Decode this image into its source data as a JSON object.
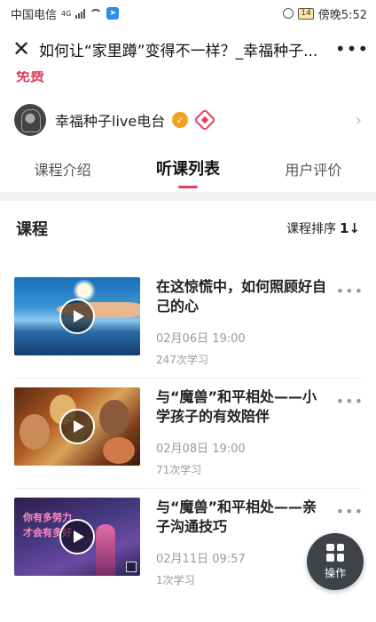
{
  "status_bar": {
    "carrier": "中国电信",
    "network": "4G",
    "battery": "14",
    "time": "傍晚5:52"
  },
  "title_bar": {
    "title": "如何让“家里蹲”变得不一样？_幸福种子..."
  },
  "free_label": "免费",
  "channel": {
    "name": "幸福种子live电台"
  },
  "tabs": [
    {
      "label": "课程介绍",
      "active": false
    },
    {
      "label": "听课列表",
      "active": true
    },
    {
      "label": "用户评价",
      "active": false
    }
  ],
  "course_section": {
    "heading": "课程",
    "sort_label": "课程排序",
    "sort_icon": "1↓"
  },
  "courses": [
    {
      "title": "在这惊慌中，如何照顾好自己的心",
      "time": "02月06日 19:00",
      "count": "247次学习"
    },
    {
      "title": "与“魔兽”和平相处——小学孩子的有效陪伴",
      "time": "02月08日 19:00",
      "count": "71次学习"
    },
    {
      "title": "与“魔兽”和平相处——亲子沟通技巧",
      "time": "02月11日 09:57",
      "count": "1次学习"
    }
  ],
  "thumb3_text": [
    "你有多努力",
    "才会有多好"
  ],
  "fab": {
    "label": "操作"
  },
  "colors": {
    "accent": "#e0415b",
    "fab": "#3f4347",
    "verified": "#f2a21d"
  }
}
